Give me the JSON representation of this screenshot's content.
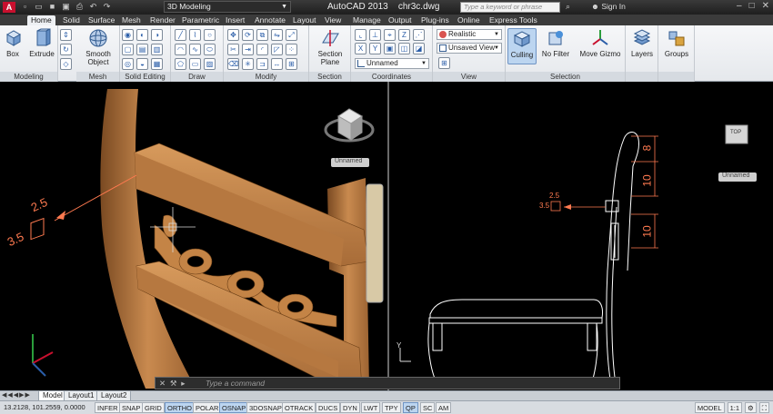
{
  "titlebar": {
    "app_icon": "A",
    "workspace": "3D Modeling",
    "app_name": "AutoCAD 2013",
    "file_name": "chr3c.dwg",
    "search_placeholder": "Type a keyword or phrase",
    "sign_in": "Sign In"
  },
  "tabs": [
    "Home",
    "Solid",
    "Surface",
    "Mesh",
    "Render",
    "Parametric",
    "Insert",
    "Annotate",
    "Layout",
    "View",
    "Manage",
    "Output",
    "Plug-ins",
    "Online",
    "Express Tools"
  ],
  "ribbon": {
    "modeling": {
      "box": "Box",
      "extrude": "Extrude",
      "label": "Modeling"
    },
    "mesh": {
      "smooth_object_1": "Smooth",
      "smooth_object_2": "Object",
      "label": "Mesh"
    },
    "solid_editing": {
      "label": "Solid Editing"
    },
    "draw": {
      "label": "Draw"
    },
    "modify": {
      "label": "Modify"
    },
    "section": {
      "section_plane_1": "Section",
      "section_plane_2": "Plane",
      "label": "Section"
    },
    "coordinates": {
      "ucs_combo": "Unnamed",
      "label": "Coordinates"
    },
    "view": {
      "visual_style": "Realistic",
      "saved_view": "Unsaved View",
      "label": "View"
    },
    "selection": {
      "culling": "Culling",
      "no_filter": "No Filter",
      "move_gizmo": "Move Gizmo",
      "label": "Selection"
    },
    "layers": {
      "label": "Layers"
    },
    "groups": {
      "label": "Groups"
    }
  },
  "viewport_left": {
    "viewcube_label": "Unnamed",
    "dim_top": "2.5",
    "dim_side": "3.5"
  },
  "viewport_right": {
    "viewcube_top": "TOP",
    "viewcube_label": "Unnamed",
    "dim_top": "2.5",
    "dim_side": "3.5",
    "dim_v1": "8",
    "dim_v2": "10",
    "dim_v3": "10",
    "ucs_axis": "Y"
  },
  "command_line": {
    "placeholder": "Type a command"
  },
  "layout_tabs": [
    "Model",
    "Layout1",
    "Layout2"
  ],
  "status": {
    "coords": "13.2128, 101.2559, 0.0000",
    "toggles": [
      {
        "label": "INFER",
        "on": false
      },
      {
        "label": "SNAP",
        "on": false
      },
      {
        "label": "GRID",
        "on": false
      },
      {
        "label": "ORTHO",
        "on": true
      },
      {
        "label": "POLAR",
        "on": false
      },
      {
        "label": "OSNAP",
        "on": true
      },
      {
        "label": "3DOSNAP",
        "on": false
      },
      {
        "label": "OTRACK",
        "on": false
      },
      {
        "label": "DUCS",
        "on": false
      },
      {
        "label": "DYN",
        "on": false
      },
      {
        "label": "LWT",
        "on": false
      },
      {
        "label": "TPY",
        "on": false
      },
      {
        "label": "QP",
        "on": true
      },
      {
        "label": "SC",
        "on": false
      },
      {
        "label": "AM",
        "on": false
      }
    ],
    "model": "MODEL",
    "scale": "1:1"
  },
  "colors": {
    "wood": "#c98a4f",
    "wood_dark": "#8a5428",
    "dimension": "#ff7a50",
    "highlight": "#4a90d9"
  }
}
